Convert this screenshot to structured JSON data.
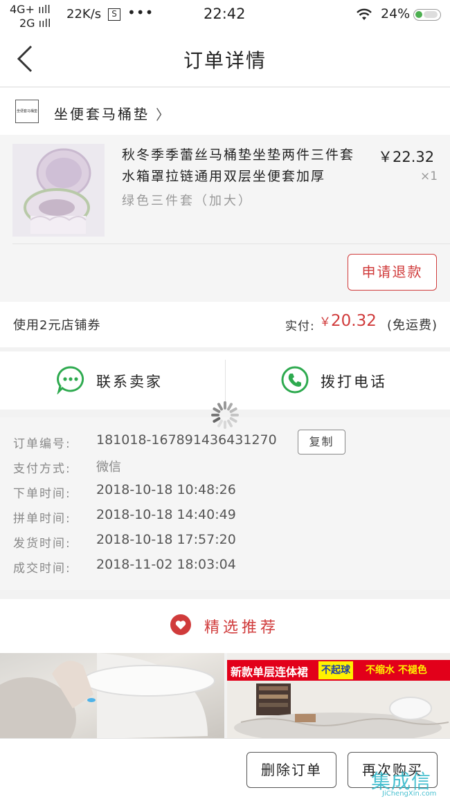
{
  "status_bar": {
    "network1": "4G+ ııll",
    "network2": "2G ııll",
    "speed": "22K/s",
    "s_icon": "S",
    "dots": "•••",
    "time": "22:42",
    "battery": "24%"
  },
  "header": {
    "title": "订单详情"
  },
  "shop": {
    "logo_text": "坐便套马桶垫",
    "name": "坐便套马桶垫",
    "arrow": "〉"
  },
  "product": {
    "title": "秋冬季季蕾丝马桶垫坐垫两件三件套水箱罩拉链通用双层坐便套加厚",
    "spec": "绿色三件套（加大）",
    "price": "￥22.32",
    "qty": "×1",
    "refund_label": "申请退款"
  },
  "payment": {
    "coupon": "使用2元店铺券",
    "paid_label": "实付:",
    "currency": "￥",
    "amount": "20.32",
    "shipping": "(免运费)"
  },
  "contact": {
    "chat_label": "联系卖家",
    "phone_label": "拨打电话"
  },
  "order_info": {
    "copy_label": "复制",
    "rows": [
      {
        "label": "订单编号:",
        "value": "181018-167891436431270"
      },
      {
        "label": "支付方式:",
        "value": "微信"
      },
      {
        "label": "下单时间:",
        "value": "2018-10-18 10:48:26"
      },
      {
        "label": "拼单时间:",
        "value": "2018-10-18 14:40:49"
      },
      {
        "label": "发货时间:",
        "value": "2018-10-18 17:57:20"
      },
      {
        "label": "成交时间:",
        "value": "2018-11-02 18:03:04"
      }
    ]
  },
  "recommend": {
    "title": "精选推荐",
    "banner_text": "新款单层连体裙",
    "tag1": "不起球",
    "tag2": "不缩水 不褪色"
  },
  "bottom": {
    "delete_label": "删除订单",
    "rebuy_label": "再次购买"
  },
  "watermark": {
    "main": "集成信",
    "sub": "JiChengXin.com"
  },
  "colors": {
    "accent": "#d03b3b",
    "green": "#2eaa4f"
  },
  "icons": [
    "back-chevron-icon",
    "wifi-icon",
    "battery-icon",
    "chat-bubble-icon",
    "phone-icon",
    "loading-spinner-icon",
    "heart-icon"
  ]
}
